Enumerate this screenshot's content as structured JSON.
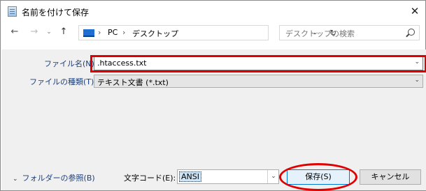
{
  "window": {
    "title": "名前を付けて保存",
    "close_glyph": "✕"
  },
  "nav": {
    "back_glyph": "←",
    "forward_glyph": "→",
    "recent_glyph": "⌄",
    "up_glyph": "↑",
    "breadcrumb": [
      "PC",
      "デスクトップ"
    ],
    "separator": "›",
    "dropdown_glyph": "⌄",
    "refresh_glyph": "↻",
    "search_placeholder": "デスクトップの検索"
  },
  "form": {
    "filename_label": "ファイル名(N):",
    "filename_value": ".htaccess.txt",
    "filetype_label": "ファイルの種類(T):",
    "filetype_value": "テキスト文書 (*.txt)",
    "dropdown_glyph": "⌄"
  },
  "footer": {
    "folder_toggle_chevron": "⌄",
    "folder_toggle_label": "フォルダーの参照(B)",
    "encoding_label": "文字コード(E):",
    "encoding_value": "ANSI",
    "encoding_dropdown_glyph": "⌄",
    "save_label": "保存(S)",
    "cancel_label": "キャンセル"
  },
  "colors": {
    "annotation_red": "#e00000",
    "accent_blue": "#0078d7"
  }
}
